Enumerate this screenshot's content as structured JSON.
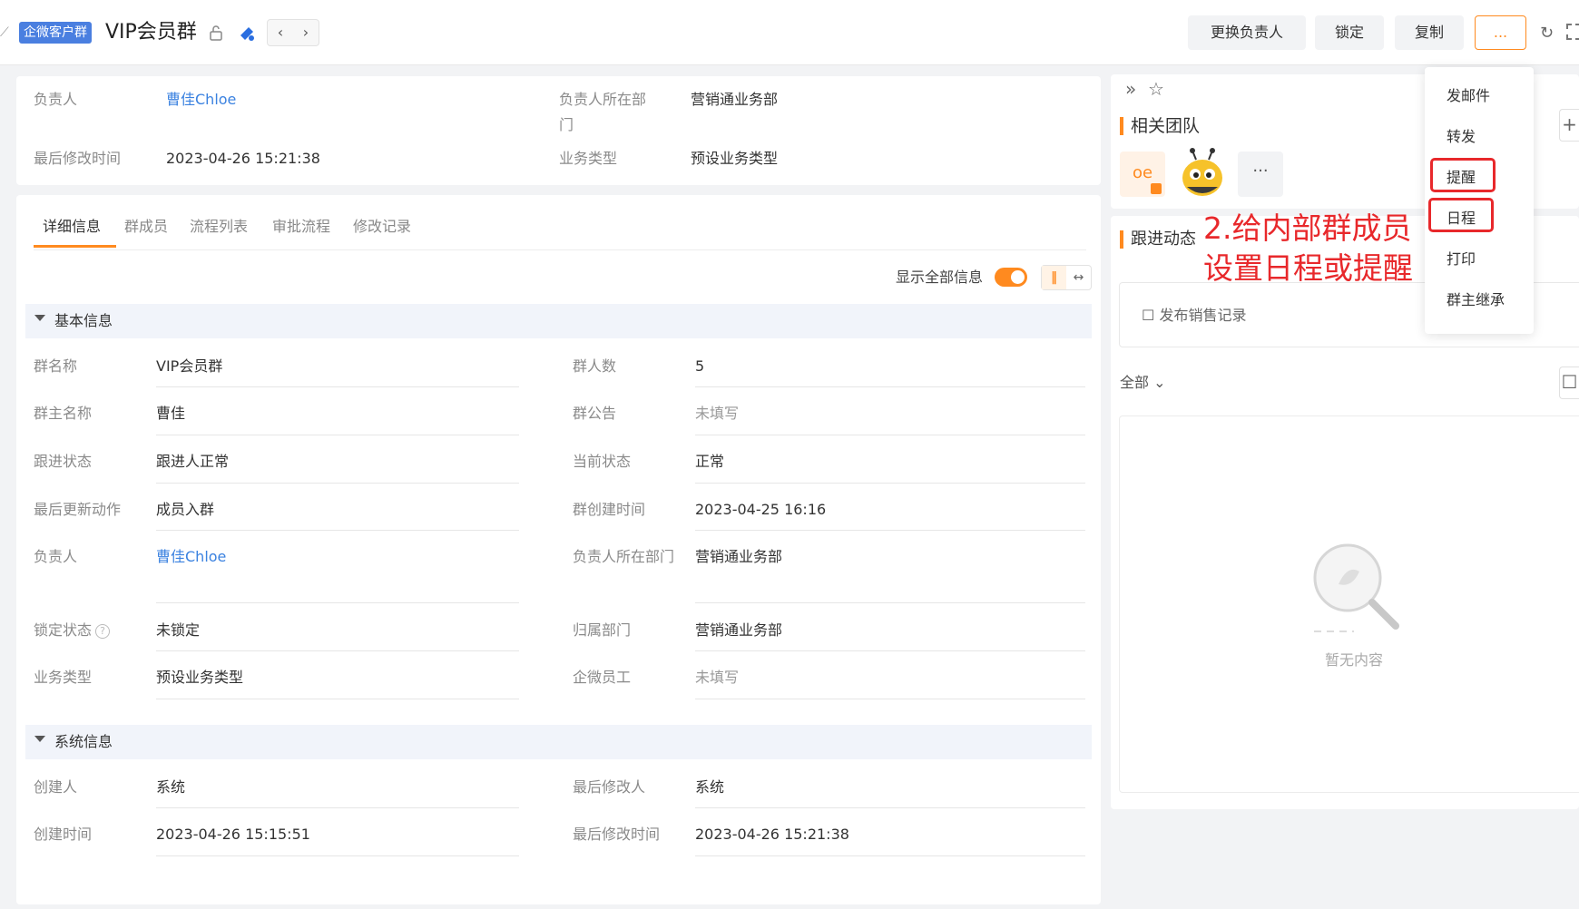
{
  "header": {
    "tag": "企微客户群",
    "title": "VIP会员群",
    "buttons": {
      "change_owner": "更换负责人",
      "lock": "锁定",
      "copy": "复制",
      "more": "..."
    }
  },
  "summary": {
    "owner_label": "负责人",
    "owner_value": "曹佳Chloe",
    "dept_label": "负责人所在部门",
    "dept_value": "营销通业务部",
    "modified_label": "最后修改时间",
    "modified_value": "2023-04-26 15:21:38",
    "biz_label": "业务类型",
    "biz_value": "预设业务类型"
  },
  "tabs": [
    "详细信息",
    "群成员",
    "流程列表",
    "审批流程",
    "修改记录"
  ],
  "show_all_label": "显示全部信息",
  "basic_section": {
    "title": "基本信息",
    "left": [
      {
        "label": "群名称",
        "value": "VIP会员群"
      },
      {
        "label": "群主名称",
        "value": "曹佳"
      },
      {
        "label": "跟进状态",
        "value": "跟进人正常"
      },
      {
        "label": "最后更新动作",
        "value": "成员入群"
      },
      {
        "label": "负责人",
        "value": "曹佳Chloe"
      },
      {
        "label": "锁定状态",
        "value": "未锁定"
      },
      {
        "label": "业务类型",
        "value": "预设业务类型"
      }
    ],
    "right": [
      {
        "label": "群人数",
        "value": "5"
      },
      {
        "label": "群公告",
        "value": "未填写"
      },
      {
        "label": "当前状态",
        "value": "正常"
      },
      {
        "label": "群创建时间",
        "value": "2023-04-25 16:16"
      },
      {
        "label": "负责人所在部门",
        "value": "营销通业务部"
      },
      {
        "label": "归属部门",
        "value": "营销通业务部"
      },
      {
        "label": "企微员工",
        "value": "未填写"
      }
    ]
  },
  "system_section": {
    "title": "系统信息",
    "left": [
      {
        "label": "创建人",
        "value": "系统"
      },
      {
        "label": "创建时间",
        "value": "2023-04-26 15:15:51"
      }
    ],
    "right": [
      {
        "label": "最后修改人",
        "value": "系统"
      },
      {
        "label": "最后修改时间",
        "value": "2023-04-26 15:21:38"
      }
    ]
  },
  "right_panel": {
    "team_title": "相关团队",
    "avatar_oe": "oe",
    "avatar_more": "···",
    "follow_title": "跟进动态",
    "post_label": "发布销售记录",
    "filter_label": "全部",
    "empty_text": "暂无内容"
  },
  "dropdown": [
    "发邮件",
    "转发",
    "提醒",
    "日程",
    "打印",
    "群主继承"
  ],
  "annotation": {
    "line1": "2.给内部群成员",
    "line2": "设置日程或提醒"
  },
  "colors": {
    "accent": "#ff8a1f",
    "link": "#3b82e0",
    "tag": "#4a7fe0",
    "highlight": "#e8282b"
  }
}
